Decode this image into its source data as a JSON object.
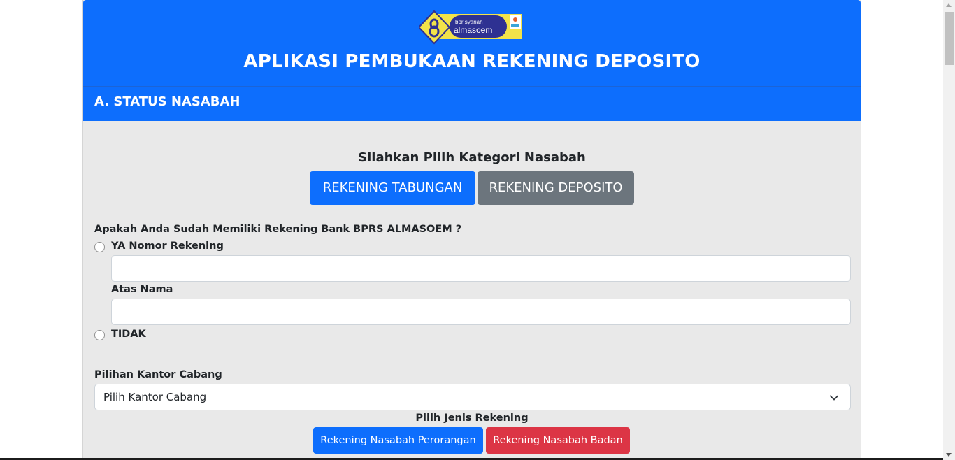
{
  "header": {
    "logo_text_small": "bpr syariah",
    "logo_text_brand": "almasoem",
    "title": "APLIKASI PEMBUKAAN REKENING DEPOSITO"
  },
  "section": {
    "title": "A. STATUS NASABAH"
  },
  "category": {
    "prompt": "Silahkan Pilih Kategori Nasabah",
    "tabungan_label": "REKENING TABUNGAN",
    "deposito_label": "REKENING DEPOSITO"
  },
  "existing_account": {
    "question": "Apakah Anda Sudah Memiliki Rekening Bank BPRS ALMASOEM ?",
    "ya_label": "YA Nomor Rekening",
    "nomor_rekening_value": "",
    "atas_nama_label": "Atas Nama",
    "atas_nama_value": "",
    "tidak_label": "TIDAK"
  },
  "branch": {
    "label": "Pilihan Kantor Cabang",
    "selected": "Pilih Kantor Cabang"
  },
  "account_type": {
    "title": "Pilih Jenis Rekening",
    "perorangan_label": "Rekening Nasabah Perorangan",
    "badan_label": "Rekening Nasabah Badan"
  },
  "colors": {
    "primary": "#0d6efd",
    "secondary": "#6c757d",
    "danger": "#dc3545",
    "panel_bg": "#e9e9e9"
  }
}
